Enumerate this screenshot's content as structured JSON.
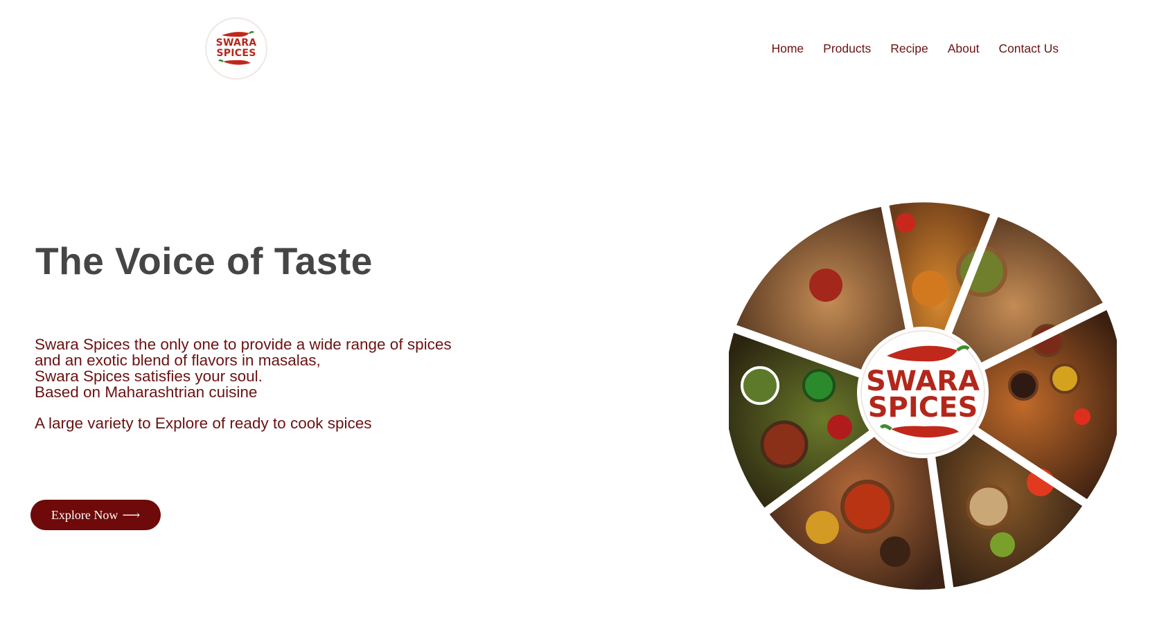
{
  "brand": {
    "logo_line1": "SWARA",
    "logo_line2": "SPICES",
    "color_primary": "#6b1212",
    "color_logo": "#b3271b"
  },
  "nav": {
    "items": [
      "Home",
      "Products",
      "Recipe",
      "About",
      "Contact Us"
    ]
  },
  "hero": {
    "title": "The Voice of Taste",
    "lines": [
      "Swara Spices the only one to provide a wide range of spices",
      "and an exotic blend of flavors in masalas,",
      "Swara Spices satisfies your soul.",
      "Based on Maharashtrian cuisine"
    ],
    "tagline": "A large variety to Explore of ready to cook spices",
    "cta_label": "Explore Now",
    "cta_arrow": "⟶"
  },
  "wheel": {
    "center_line1": "SWARA",
    "center_line2": "SPICES"
  }
}
